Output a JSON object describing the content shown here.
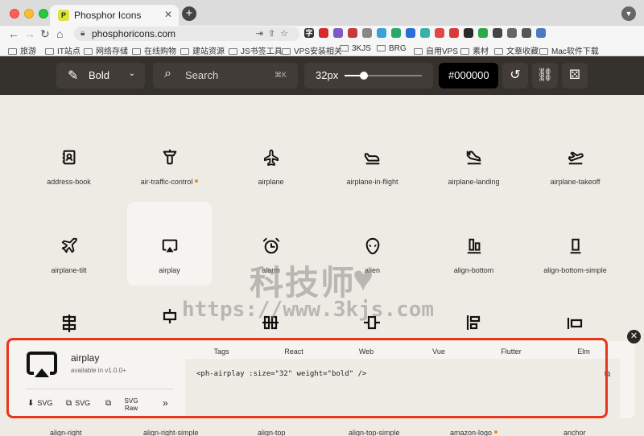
{
  "browser": {
    "tab_title": "Phosphor Icons",
    "tab_favicon": "P",
    "new_tab": "+",
    "url": "phosphoricons.com",
    "extensions": [
      {
        "label": "字",
        "color": "#333333"
      },
      {
        "label": "",
        "color": "#d62b2b"
      },
      {
        "label": "",
        "color": "#7a5cc4"
      },
      {
        "label": "",
        "color": "#c43b3b"
      },
      {
        "label": "",
        "color": "#888888"
      },
      {
        "label": "",
        "color": "#3aa0d8"
      },
      {
        "label": "",
        "color": "#2aa86a"
      },
      {
        "label": "",
        "color": "#2a6fd8"
      },
      {
        "label": "",
        "color": "#36b3a8"
      },
      {
        "label": "",
        "color": "#e04848"
      },
      {
        "label": "",
        "color": "#d83a3a"
      },
      {
        "label": "",
        "color": "#2a2a2a"
      },
      {
        "label": "",
        "color": "#2aa84a"
      },
      {
        "label": "",
        "color": "#444444"
      },
      {
        "label": "",
        "color": "#666666"
      },
      {
        "label": "",
        "color": "#555555"
      },
      {
        "label": "",
        "color": "#4a7ac4"
      }
    ],
    "bookmarks": [
      "旅游",
      "IT站点",
      "网络存储",
      "在线购物",
      "建站资源",
      "JS书签工具",
      "VPS安装相关",
      "3KJS",
      "BRG",
      "自用VPS",
      "素材",
      "文章收藏",
      "Mac软件下载"
    ]
  },
  "toolbar": {
    "weight": "Bold",
    "search_placeholder": "Search",
    "search_shortcut": "⌘K",
    "size": "32px",
    "size_level": 0.25,
    "color": "#000000",
    "accent": "#35312d"
  },
  "icons": [
    {
      "name": "address-book",
      "glyph": "address-book-icon",
      "dot": false
    },
    {
      "name": "air-traffic-control",
      "glyph": "air-traffic-control-icon",
      "dot": true
    },
    {
      "name": "airplane",
      "glyph": "airplane-icon",
      "dot": false
    },
    {
      "name": "airplane-in-flight",
      "glyph": "airplane-in-flight-icon",
      "dot": false
    },
    {
      "name": "airplane-landing",
      "glyph": "airplane-landing-icon",
      "dot": false
    },
    {
      "name": "airplane-takeoff",
      "glyph": "airplane-takeoff-icon",
      "dot": false
    },
    {
      "name": "airplane-tilt",
      "glyph": "airplane-tilt-icon",
      "dot": false
    },
    {
      "name": "airplay",
      "glyph": "airplay-icon",
      "dot": false,
      "selected": true
    },
    {
      "name": "alarm",
      "glyph": "alarm-icon",
      "dot": false
    },
    {
      "name": "alien",
      "glyph": "alien-icon",
      "dot": false
    },
    {
      "name": "align-bottom",
      "glyph": "align-bottom-icon",
      "dot": false
    },
    {
      "name": "align-bottom-simple",
      "glyph": "align-bottom-simple-icon",
      "dot": false
    }
  ],
  "bottom_row": [
    {
      "name": "align-right",
      "dot": false
    },
    {
      "name": "align-right-simple",
      "dot": false
    },
    {
      "name": "align-top",
      "dot": false
    },
    {
      "name": "align-top-simple",
      "dot": false
    },
    {
      "name": "amazon-logo",
      "dot": true
    },
    {
      "name": "anchor",
      "dot": false
    }
  ],
  "details": {
    "name": "airplay",
    "version": "available in v1.0.0+",
    "downloads": [
      "SVG",
      "SVG",
      "SVG Raw"
    ],
    "more": "»",
    "tabs": [
      "Tags",
      "React",
      "Web",
      "Vue",
      "Flutter",
      "Elm"
    ],
    "active_tab": "Vue",
    "code": "<ph-airplay :size=\"32\" weight=\"bold\" />",
    "highlight_color": "#e8361c"
  },
  "watermark": {
    "title": "科技师",
    "url": "https://www.3kjs.com"
  }
}
